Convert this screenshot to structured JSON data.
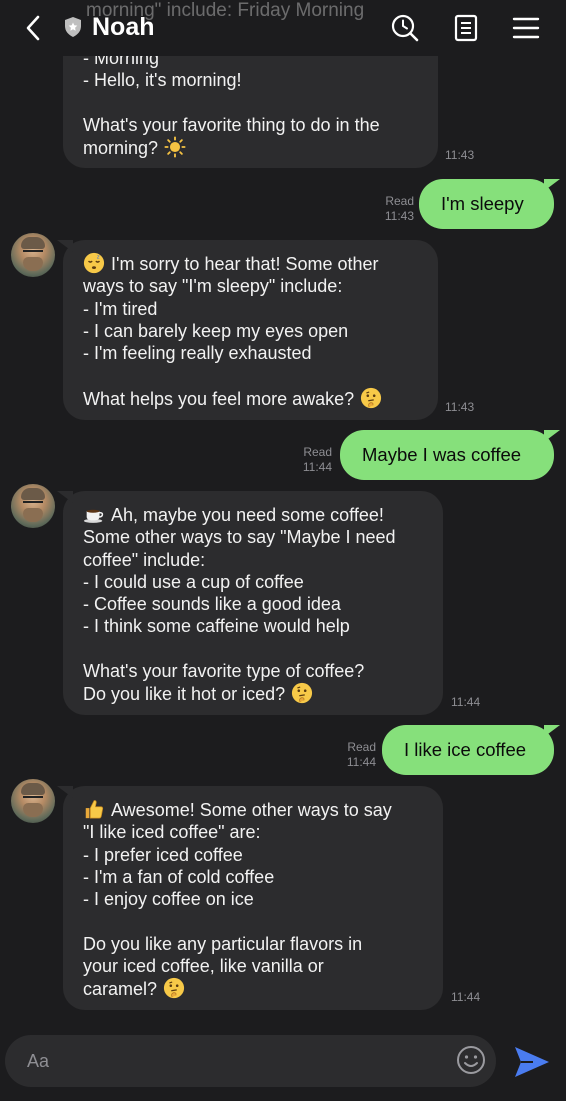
{
  "header": {
    "title": "Noah",
    "ghost_text": "morning\" include: Friday Morning",
    "icons": [
      "back-chevron-icon",
      "shield-icon",
      "search-clock-icon",
      "notes-icon",
      "menu-icon"
    ]
  },
  "messages": [
    {
      "id": "m1",
      "direction": "in",
      "lines": [
        "- Morning",
        "- Hello, it's morning!",
        "",
        "What's your favorite thing to do in the",
        "morning?"
      ],
      "emoji_end": "sun",
      "time": "11:43"
    },
    {
      "id": "m2",
      "direction": "out",
      "text": "I'm sleepy",
      "read": "Read",
      "time": "11:43"
    },
    {
      "id": "m3",
      "direction": "in",
      "emoji_start": "sleepy",
      "lines": [
        "I'm sorry to hear that! Some other",
        "ways to say \"I'm sleepy\" include:",
        "- I'm tired",
        "- I can barely keep my eyes open",
        "- I'm feeling really exhausted",
        "",
        "What helps you feel more awake?"
      ],
      "emoji_end": "thinking",
      "time": "11:43"
    },
    {
      "id": "m4",
      "direction": "out",
      "text": "Maybe I was coffee",
      "read": "Read",
      "time": "11:44"
    },
    {
      "id": "m5",
      "direction": "in",
      "emoji_start": "coffee",
      "lines": [
        "Ah, maybe you need some coffee!",
        "Some other ways to say \"Maybe I need",
        "coffee\" include:",
        "- I could use a cup of coffee",
        "- Coffee sounds like a good idea",
        "- I think some caffeine would help",
        "",
        "What's your favorite type of coffee?",
        "Do you like it hot or iced?"
      ],
      "emoji_end": "thinking",
      "time": "11:44"
    },
    {
      "id": "m6",
      "direction": "out",
      "text": "I like ice coffee",
      "read": "Read",
      "time": "11:44"
    },
    {
      "id": "m7",
      "direction": "in",
      "emoji_start": "thumbs-up",
      "lines": [
        "Awesome! Some other ways to say",
        "\"I like iced coffee\" are:",
        "- I prefer iced coffee",
        "- I'm a fan of cold coffee",
        "- I enjoy coffee on ice",
        "",
        "Do you like any particular flavors in",
        "your iced coffee, like vanilla or",
        "caramel?"
      ],
      "emoji_end": "thinking",
      "time": "11:44"
    }
  ],
  "composer": {
    "placeholder": "Aa",
    "icons": [
      "smiley-icon",
      "send-icon"
    ]
  },
  "colors": {
    "background": "#1c1c1e",
    "incoming_bubble": "#2c2c2e",
    "outgoing_bubble": "#86e07b",
    "send_button": "#4a7cf0",
    "meta_text": "#8e8e93"
  }
}
